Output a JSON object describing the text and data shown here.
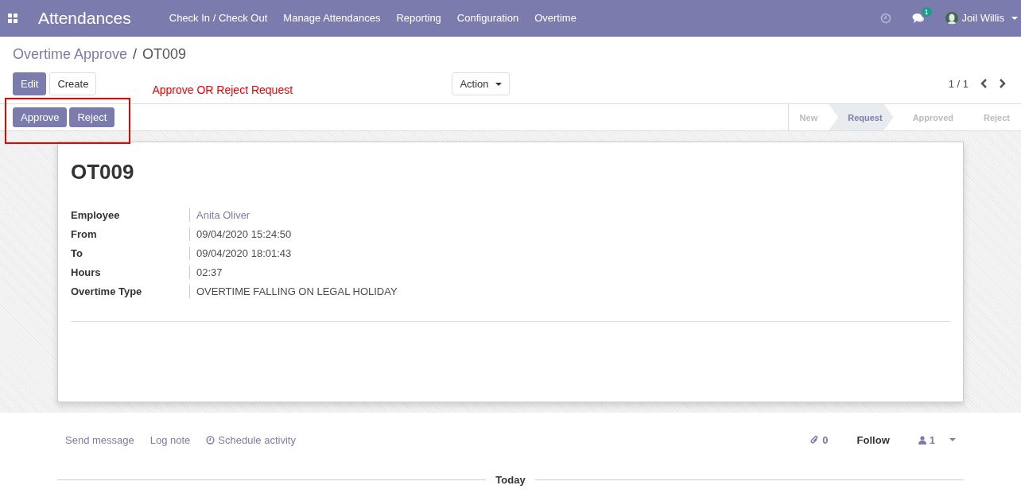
{
  "navbar": {
    "app_title": "Attendances",
    "menu": [
      {
        "label": "Check In / Check Out"
      },
      {
        "label": "Manage Attendances"
      },
      {
        "label": "Reporting"
      },
      {
        "label": "Configuration"
      },
      {
        "label": "Overtime"
      }
    ],
    "message_count": "1",
    "user": "Joil Willis"
  },
  "breadcrumb": {
    "parent": "Overtime Approve",
    "separator": "/",
    "current": "OT009"
  },
  "control_buttons": [
    "Edit",
    "Create"
  ],
  "action_button": "Action",
  "pager": "1 / 1",
  "annotation": "Approve OR Reject Request",
  "header_buttons": [
    "Approve",
    "Reject"
  ],
  "stages": [
    {
      "label": "New",
      "selected": false
    },
    {
      "label": "Request",
      "selected": true
    },
    {
      "label": "Approved",
      "selected": false
    },
    {
      "label": "Reject",
      "selected": false
    }
  ],
  "record": {
    "title": "OT009",
    "fields": [
      {
        "label": "Employee",
        "value": "Anita Oliver",
        "kind": "link"
      },
      {
        "label": "From",
        "value": "09/04/2020 15:24:50",
        "kind": "text"
      },
      {
        "label": "To",
        "value": "09/04/2020 18:01:43",
        "kind": "text"
      },
      {
        "label": "Hours",
        "value": "02:37",
        "kind": "text"
      },
      {
        "label": "Overtime Type",
        "value": "OVERTIME FALLING ON LEGAL HOLIDAY",
        "kind": "text"
      }
    ]
  },
  "chatter": {
    "send_message": "Send message",
    "log_note": "Log note",
    "schedule_activity": "Schedule activity",
    "attachments": "0",
    "follow": "Follow",
    "followers": "1",
    "today": "Today"
  }
}
